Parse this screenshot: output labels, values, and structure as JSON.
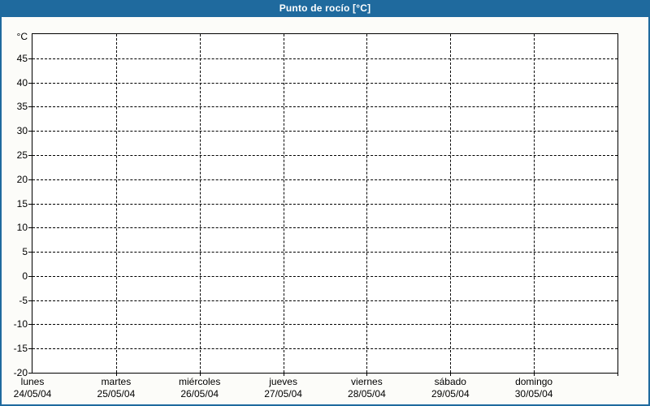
{
  "title_bar": {
    "title": "Punto de rocío [°C]"
  },
  "chart_data": {
    "type": "line",
    "title": "Punto de rocío [°C]",
    "ylabel": "°C",
    "ylim": [
      -20,
      50
    ],
    "ytick_interval": 5,
    "yticks": [
      45,
      40,
      35,
      30,
      25,
      20,
      15,
      10,
      5,
      0,
      -5,
      -10,
      -15,
      -20
    ],
    "categories": [
      {
        "day": "lunes",
        "date": "24/05/04"
      },
      {
        "day": "martes",
        "date": "25/05/04"
      },
      {
        "day": "miércoles",
        "date": "26/05/04"
      },
      {
        "day": "jueves",
        "date": "27/05/04"
      },
      {
        "day": "viernes",
        "date": "28/05/04"
      },
      {
        "day": "sábado",
        "date": "29/05/04"
      },
      {
        "day": "domingo",
        "date": "30/05/04"
      }
    ],
    "series": [],
    "grid": "dashed",
    "legend_position": "none"
  },
  "colors": {
    "accent": "#1F6A9E",
    "page_background": "#FCFCF9",
    "plot_background": "#FFFFFF",
    "grid": "#000000",
    "title_text": "#FFFFFF",
    "label_text": "#000000"
  }
}
